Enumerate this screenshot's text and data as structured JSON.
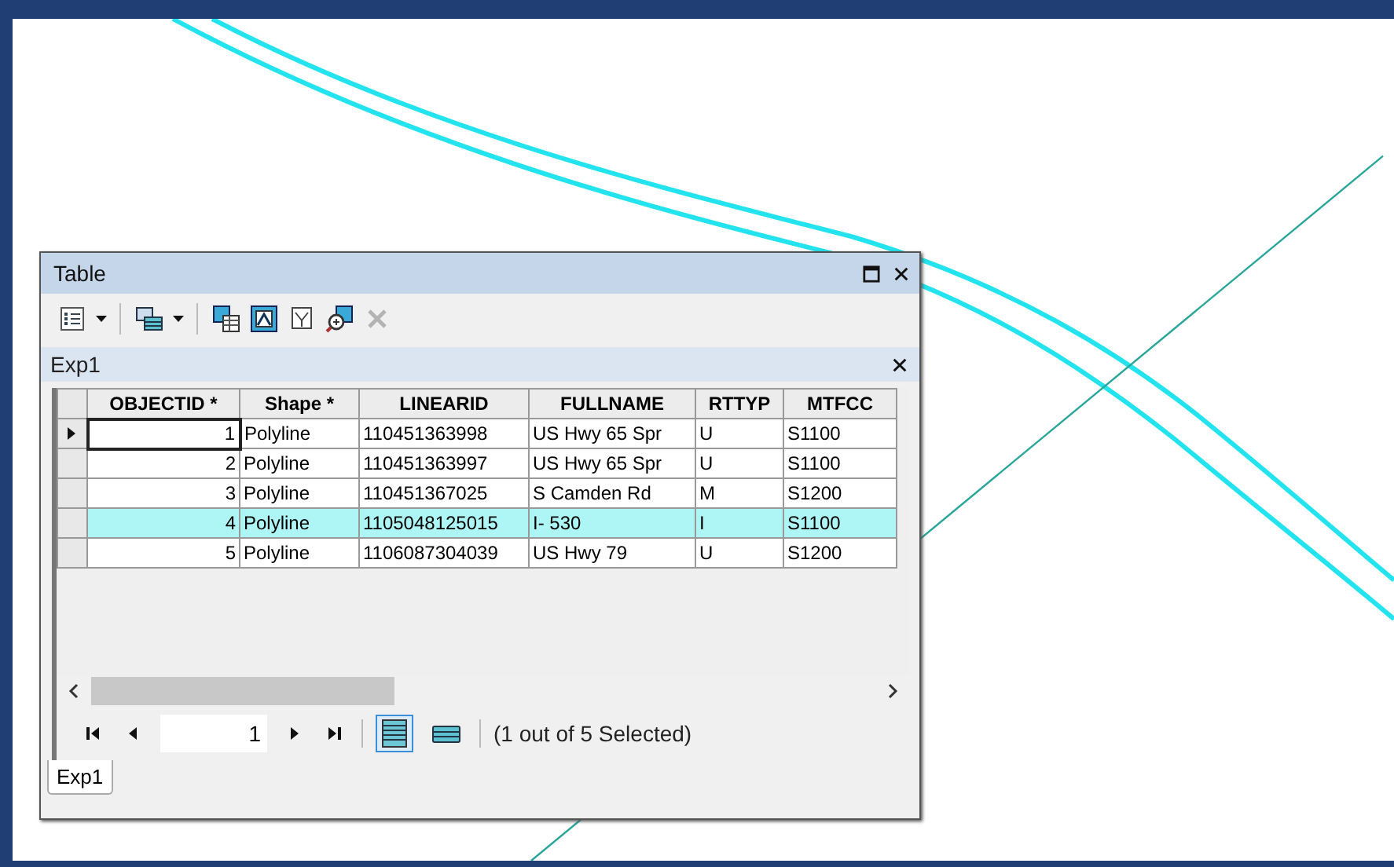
{
  "window": {
    "title": "Table"
  },
  "toolbar": [
    {
      "kind": "options",
      "disabled": false
    },
    {
      "kind": "relate",
      "disabled": false
    },
    {
      "kind": "select",
      "disabled": false
    },
    {
      "kind": "switch",
      "disabled": false
    },
    {
      "kind": "clear",
      "disabled": false
    },
    {
      "kind": "zoom",
      "disabled": false
    },
    {
      "kind": "delete",
      "disabled": true
    }
  ],
  "table": {
    "name": "Exp1",
    "columns": [
      "OBJECTID *",
      "Shape *",
      "LINEARID",
      "FULLNAME",
      "RTTYP",
      "MTFCC"
    ],
    "rows": [
      {
        "current": true,
        "selected": false,
        "cells": [
          "1",
          "Polyline",
          "110451363998",
          "US Hwy 65 Spr",
          "U",
          "S1100"
        ]
      },
      {
        "current": false,
        "selected": false,
        "cells": [
          "2",
          "Polyline",
          "110451363997",
          "US Hwy 65 Spr",
          "U",
          "S1100"
        ]
      },
      {
        "current": false,
        "selected": false,
        "cells": [
          "3",
          "Polyline",
          "110451367025",
          "S Camden Rd",
          "M",
          "S1200"
        ]
      },
      {
        "current": false,
        "selected": true,
        "cells": [
          "4",
          "Polyline",
          "1105048125015",
          "I- 530",
          "I",
          "S1100"
        ]
      },
      {
        "current": false,
        "selected": false,
        "cells": [
          "5",
          "Polyline",
          "1106087304039",
          "US Hwy 79",
          "U",
          "S1200"
        ]
      }
    ]
  },
  "navigator": {
    "record": "1",
    "views": [
      {
        "kind": "all",
        "selected": true
      },
      {
        "kind": "selected",
        "selected": false
      }
    ],
    "status": "(1 out of 5 Selected)"
  },
  "tabs": [
    {
      "label": "Exp1",
      "selected": true
    }
  ]
}
